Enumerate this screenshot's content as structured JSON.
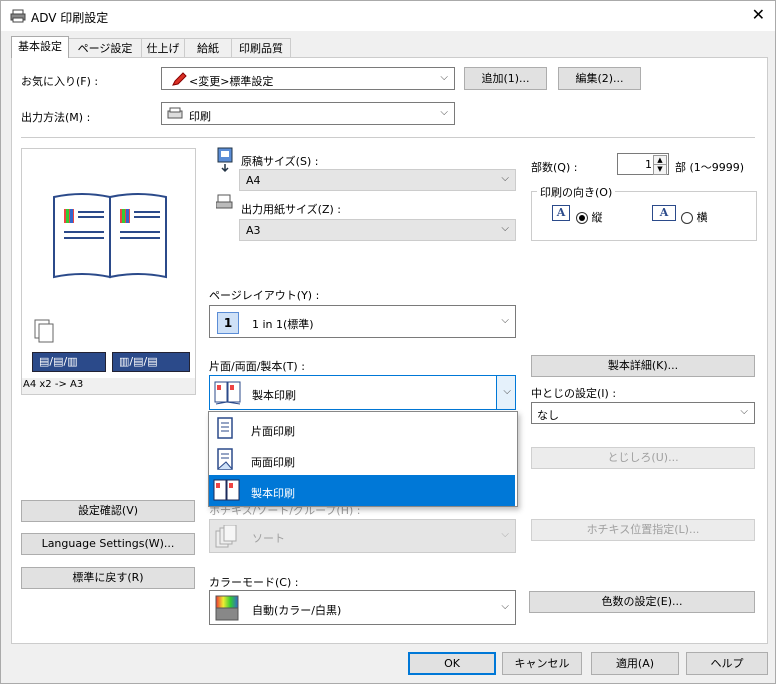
{
  "window": {
    "title": "ADV 印刷設定",
    "close": "✕"
  },
  "tabs": [
    "基本設定",
    "ページ設定",
    "仕上げ",
    "給紙",
    "印刷品質"
  ],
  "favorites": {
    "label": "お気に入り(F) :",
    "value": "<変更>標準設定",
    "add_button": "追加(1)...",
    "edit_button": "編集(2)..."
  },
  "output": {
    "label": "出力方法(M) :",
    "value": "印刷"
  },
  "preview": {
    "caption": "A4 x2 -> A3"
  },
  "original_size": {
    "label": "原稿サイズ(S) :",
    "value": "A4"
  },
  "output_paper": {
    "label": "出力用紙サイズ(Z) :",
    "value": "A3"
  },
  "copies": {
    "label": "部数(Q) :",
    "value": "1",
    "unit": "部 (1〜9999)"
  },
  "orientation": {
    "label": "印刷の向き(O)",
    "portrait": "縦",
    "landscape": "横",
    "selected": "portrait"
  },
  "page_layout": {
    "label": "ページレイアウト(Y) :",
    "value": "1 in 1(標準)",
    "icon_number": "1"
  },
  "duplex": {
    "label": "片面/両面/製本(T) :",
    "value": "製本印刷",
    "options": [
      "片面印刷",
      "両面印刷",
      "製本印刷"
    ],
    "selected_index": 2
  },
  "booklet_detail_button": "製本詳細(K)...",
  "saddle": {
    "label": "中とじの設定(I) :",
    "value": "なし"
  },
  "binding_button": "とじしろ(U)...",
  "staple": {
    "label": "ホチキス/ソート/グループ(H) :",
    "value": "ソート"
  },
  "staple_pos_button": "ホチキス位置指定(L)...",
  "left_buttons": {
    "confirm": "設定確認(V)",
    "language": "Language Settings(W)...",
    "reset": "標準に戻す(R)"
  },
  "color_mode": {
    "label": "カラーモード(C) :",
    "value": "自動(カラー/白黒)"
  },
  "color_count_button": "色数の設定(E)...",
  "footer": {
    "ok": "OK",
    "cancel": "キャンセル",
    "apply": "適用(A)",
    "help": "ヘルプ"
  },
  "colors": {
    "accent": "#0078d7",
    "selection_text": "#ffffff"
  }
}
